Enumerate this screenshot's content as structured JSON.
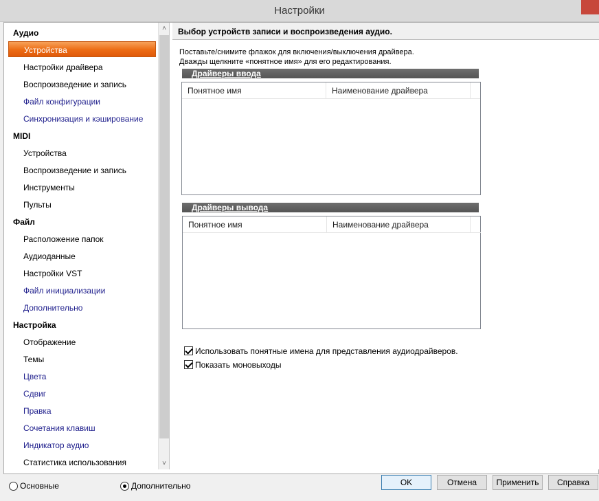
{
  "window": {
    "title": "Настройки"
  },
  "sidebar": {
    "categories": [
      {
        "label": "Аудио",
        "items": [
          "Устройства",
          "Настройки драйвера",
          "Воспроизведение и запись",
          "Файл конфигурации",
          "Синхронизация и кэширование"
        ]
      },
      {
        "label": "MIDI",
        "items": [
          "Устройства",
          "Воспроизведение и запись",
          "Инструменты",
          "Пульты"
        ]
      },
      {
        "label": "Файл",
        "items": [
          "Расположение папок",
          "Аудиоданные",
          "Настройки VST",
          "Файл инициализации",
          "Дополнительно"
        ]
      },
      {
        "label": "Настройка",
        "items": [
          "Отображение",
          "Темы",
          "Цвета",
          "Сдвиг",
          "Правка",
          "Сочетания клавиш",
          "Индикатор аудио",
          "Статистика использования"
        ]
      }
    ],
    "selected_item": "Устройства",
    "scroll_up_icon": "˄",
    "scroll_down_icon": "˅"
  },
  "content": {
    "header": "Выбор устройств записи и воспроизведения аудио.",
    "instruction_line1": "Поставьте/снимите флажок для включения/выключения драйвера.",
    "instruction_line2": "Дважды щелкните «понятное имя» для его редактирования.",
    "input_group": {
      "title": "Драйверы ввода",
      "col1": "Понятное имя",
      "col2": "Наименование драйвера"
    },
    "output_group": {
      "title": "Драйверы вывода",
      "col1": "Понятное имя",
      "col2": "Наименование драйвера"
    },
    "checkbox_friendly_names": "Использовать понятные имена для представления аудиодрайверов.",
    "checkbox_show_mono": "Показать моновыходы"
  },
  "footer": {
    "radio_basic": "Основные",
    "radio_advanced": "Дополнительно",
    "ok": "OK",
    "cancel": "Отмена",
    "apply": "Применить",
    "help": "Справка"
  }
}
